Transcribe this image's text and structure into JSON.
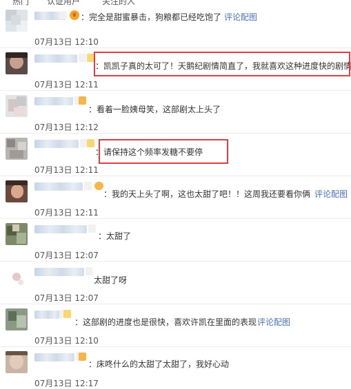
{
  "tabs": [
    "热门",
    "认证用户",
    "关注的人"
  ],
  "highlight_color": "#e23b43",
  "link_color": "#4a72b8",
  "comments": [
    {
      "text": "：完全是甜蜜暴击，狗粮都已经吃饱了",
      "link": "评论配图",
      "time": "07月13日 12:10",
      "badge": "crown-icon"
    },
    {
      "text": "：凯凯子真的太可了！天鹅纪剧情简直了，我就喜欢这种进度快的剧情！",
      "time": "07月13日 12:11",
      "badge": "member-badge-icon"
    },
    {
      "text": "：看着一脸姨母笑，这部剧太上头了",
      "time": "07月13日 12:12",
      "badge": "member-badge-icon"
    },
    {
      "text": "：请保持这个频率发糖不要停",
      "time": "07月13日 12:11",
      "badge": "member-badge-icon"
    },
    {
      "text": "：我的天上头了啊，这也太甜了吧！！这周我还要看你俩",
      "link": "评论配图",
      "time": "07月13日 12:11",
      "badge": "heart-badge-icon"
    },
    {
      "text": "：太甜了",
      "time": "07月13日 12:07",
      "badge": "none"
    },
    {
      "text": "太甜了呀",
      "time": "07月13日 12:07",
      "badge": "none"
    },
    {
      "text": "：这部剧的进度也是很快，喜欢许凯在里面的表现",
      "link": "评论配图",
      "time": "07月13日 12:10",
      "badge": "member-badge-icon"
    },
    {
      "text": "：床咚什么的太甜了太甜了，我好心动",
      "time": "07月13日 12:17",
      "badge": "member-badge-icon"
    }
  ]
}
